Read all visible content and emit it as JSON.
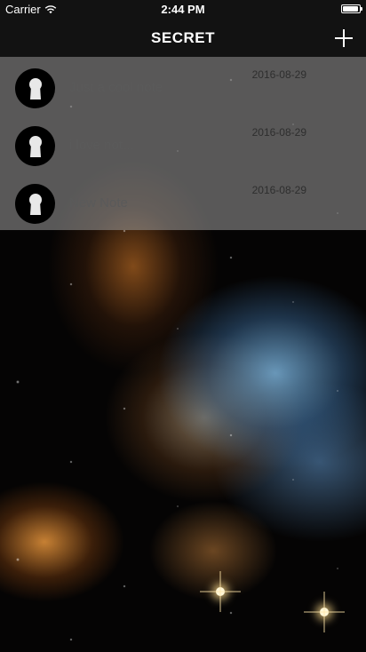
{
  "status_bar": {
    "carrier": "Carrier",
    "time": "2:44 PM",
    "battery_level": 0.95
  },
  "nav": {
    "title": "SECRET",
    "add_icon": "plus-icon"
  },
  "notes": [
    {
      "title": "Just a cool note",
      "date": "2016-08-29",
      "icon": "keyhole-lock-icon"
    },
    {
      "title": "i love not...",
      "date": "2016-08-29",
      "icon": "keyhole-lock-icon"
    },
    {
      "title": "New Note",
      "date": "2016-08-29",
      "icon": "keyhole-lock-icon"
    }
  ],
  "colors": {
    "bar_background": "#121212",
    "list_overlay": "rgba(150,150,150,0.58)",
    "note_title_text": "#5a5a5a",
    "note_date_text": "#2e2e2e"
  }
}
